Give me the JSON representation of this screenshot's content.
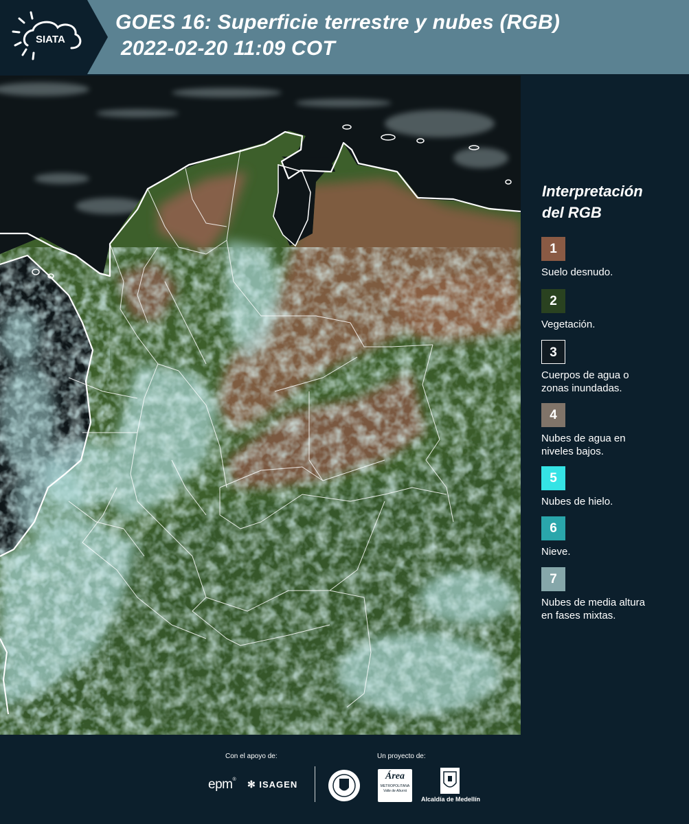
{
  "header": {
    "logo_text": "SIATA",
    "title_line1": "GOES 16: Superficie terrestre y nubes (RGB)",
    "title_line2": "2022-02-20 11:09 COT"
  },
  "legend": {
    "title_line1": "Interpretación",
    "title_line2": "del RGB",
    "items": [
      {
        "num": "1",
        "label_line1": "Suelo desnudo.",
        "label_line2": "",
        "color": "#8a5a44"
      },
      {
        "num": "2",
        "label_line1": "Vegetación.",
        "label_line2": "",
        "color": "#2a4220"
      },
      {
        "num": "3",
        "label_line1": "Cuerpos de agua o",
        "label_line2": "zonas inundadas.",
        "color": "#111b22"
      },
      {
        "num": "4",
        "label_line1": "Nubes de agua en",
        "label_line2": "niveles bajos.",
        "color": "#807469"
      },
      {
        "num": "5",
        "label_line1": "Nubes de hielo.",
        "label_line2": "",
        "color": "#35e3e5"
      },
      {
        "num": "6",
        "label_line1": "Nieve.",
        "label_line2": "",
        "color": "#2aa6ab"
      },
      {
        "num": "7",
        "label_line1": "Nubes de media altura",
        "label_line2": "en fases mixtas.",
        "color": "#86a7aa"
      }
    ]
  },
  "footer": {
    "support_label": "Con el apoyo de:",
    "project_label": "Un proyecto de:",
    "epm": "epm",
    "isagen": "ISAGEN",
    "area_line1": "Área",
    "area_line2": "METROPOLITANA",
    "area_line3": "Valle de Aburrá",
    "alcaldia": "Alcaldía de Medellín"
  },
  "colors": {
    "header_bg": "#5b8292",
    "page_bg": "#0c1f2c",
    "ocean": "#0e1518",
    "vegetation": "#3d5f2b",
    "bare_soil": "#7e5b41",
    "cloud": "#a9d6d6"
  }
}
